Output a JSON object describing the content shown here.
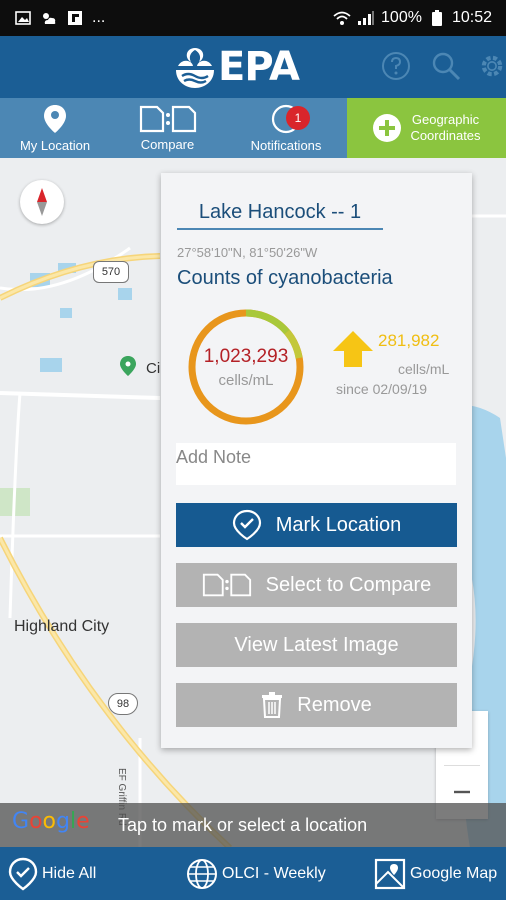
{
  "status_bar": {
    "ellipsis": "...",
    "battery": "100%",
    "time": "10:52"
  },
  "header": {
    "logo_text": "EPA",
    "icons": [
      "help-icon",
      "search-icon",
      "gear-icon"
    ]
  },
  "toolbar": {
    "items": [
      {
        "label": "My Location",
        "icon": "location-pin-icon"
      },
      {
        "label": "Compare",
        "icon": "compare-icon"
      },
      {
        "label": "Notifications",
        "icon": "notifications-icon",
        "badge": "1"
      }
    ],
    "geo_label_line1": "Geographic",
    "geo_label_line2": "Coordinates"
  },
  "map": {
    "labels": {
      "city_partial": "Ci",
      "highland_city": "Highland City",
      "road_vertical": "EF Griffin Rd"
    },
    "route_shields": [
      "570",
      "98"
    ]
  },
  "popup": {
    "location_name": "Lake Hancock -- 1",
    "coordinates": "27°58'10\"N, 81°50'26\"W",
    "metric_title": "Counts of cyanobacteria",
    "count_value": "1,023,293",
    "count_unit": "cells/mL",
    "trend_value": "281,982",
    "trend_unit": "cells/mL",
    "trend_since": "since 02/09/19",
    "note_placeholder": "Add Note",
    "buttons": {
      "mark": "Mark Location",
      "compare": "Select to Compare",
      "latest_image": "View Latest Image",
      "remove": "Remove"
    }
  },
  "attribution": {
    "google": "Google",
    "hint": "Tap to mark or select a location"
  },
  "bottom_bar": {
    "hide_all": "Hide All",
    "layer": "OLCI - Weekly",
    "basemap": "Google Map"
  },
  "colors": {
    "header_blue": "#1b5e95",
    "toolbar_blue": "#4c87b4",
    "geo_green": "#8bc53f",
    "primary_button": "#165a91",
    "grey_button": "#b3b3b3",
    "count_red": "#b42126",
    "trend_yellow": "#f0be12",
    "ring_orange": "#e8961c",
    "ring_green": "#8bc53f",
    "badge_red": "#d9252b"
  }
}
